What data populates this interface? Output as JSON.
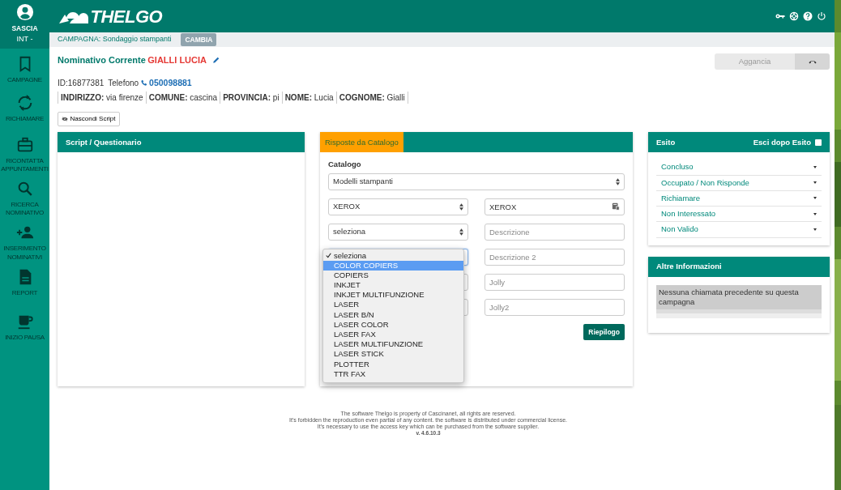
{
  "sidebar": {
    "user": {
      "name": "SASCIA",
      "role": "INT -"
    },
    "items": [
      {
        "label": "CAMPAGNE"
      },
      {
        "label": "RICHIAMARE"
      },
      {
        "label": "RICONTATTA APPUNTAMENTI"
      },
      {
        "label": "RICERCA NOMINATIVO"
      },
      {
        "label": "INSERIMENTO NOMINATIVI"
      },
      {
        "label": "REPORT"
      },
      {
        "label": "INIZIO PAUSA"
      }
    ]
  },
  "header": {
    "logo": "THELGO"
  },
  "campaign_bar": {
    "label": "CAMPAGNA: Sondaggio stampanti",
    "button": "CAMBIA"
  },
  "contact": {
    "heading": "Nominativo Corrente",
    "name": "GIALLI LUCIA",
    "id": "ID:16877381",
    "phone_label": "Telefono",
    "phone": "050098881",
    "fields": [
      {
        "label": "INDIRIZZO:",
        "value": "via firenze"
      },
      {
        "label": "COMUNE:",
        "value": "cascina"
      },
      {
        "label": "PROVINCIA:",
        "value": "pi"
      },
      {
        "label": "NOME:",
        "value": "Lucia"
      },
      {
        "label": "COGNOME:",
        "value": "Gialli"
      }
    ]
  },
  "hangup": {
    "label": "Aggancia"
  },
  "hide_script_button": "Nascondi Script",
  "script_panel": {
    "title": "Script / Questionario"
  },
  "catalog_panel": {
    "tab": "Risposte da Catalogo",
    "catalog_label": "Catalogo",
    "catalog_value": "Modelli stampanti",
    "left_selects": [
      {
        "value": "XEROX",
        "open": false
      },
      {
        "value": "seleziona",
        "open": false
      },
      {
        "open": true
      },
      {
        "open": false
      },
      {
        "open": false
      }
    ],
    "right_fields": [
      {
        "value": "XEROX"
      },
      {
        "placeholder": "Descrizione"
      },
      {
        "placeholder": "Descrizione 2"
      },
      {
        "placeholder": "Jolly"
      },
      {
        "placeholder": "Jolly2"
      }
    ],
    "options": [
      {
        "label": "seleziona",
        "checked": true,
        "highlighted": false
      },
      {
        "label": "COLOR COPIERS",
        "checked": false,
        "highlighted": true
      },
      {
        "label": "COPIERS",
        "checked": false,
        "highlighted": false
      },
      {
        "label": "INKJET",
        "checked": false,
        "highlighted": false
      },
      {
        "label": "INKJET MULTIFUNZIONE",
        "checked": false,
        "highlighted": false
      },
      {
        "label": "LASER",
        "checked": false,
        "highlighted": false
      },
      {
        "label": "LASER B/N",
        "checked": false,
        "highlighted": false
      },
      {
        "label": "LASER COLOR",
        "checked": false,
        "highlighted": false
      },
      {
        "label": "LASER FAX",
        "checked": false,
        "highlighted": false
      },
      {
        "label": "LASER MULTIFUNZIONE",
        "checked": false,
        "highlighted": false
      },
      {
        "label": "LASER STICK",
        "checked": false,
        "highlighted": false
      },
      {
        "label": "PLOTTER",
        "checked": false,
        "highlighted": false
      },
      {
        "label": "TTR FAX",
        "checked": false,
        "highlighted": false
      }
    ],
    "button": "Riepilogo"
  },
  "esito_panel": {
    "title": "Esito",
    "exit_label": "Esci dopo Esito",
    "exit_checked": false,
    "items": [
      "Concluso",
      "Occupato / Non Risponde",
      "Richiamare",
      "Non Interessato",
      "Non Valido"
    ]
  },
  "info_panel": {
    "title": "Altre Informazioni",
    "message": "Nessuna chiamata precedente su questa campagna"
  },
  "footer": {
    "lines": [
      "The software Thelgo is property of Cascinanet, all rights are reserved.",
      "It's forbidden the reproduction even partial of any content. the software is distributed under commercial license.",
      "It's necessary to use the access key which can be purchased from the software supplier."
    ],
    "version": "v. 4.6.10.3"
  }
}
